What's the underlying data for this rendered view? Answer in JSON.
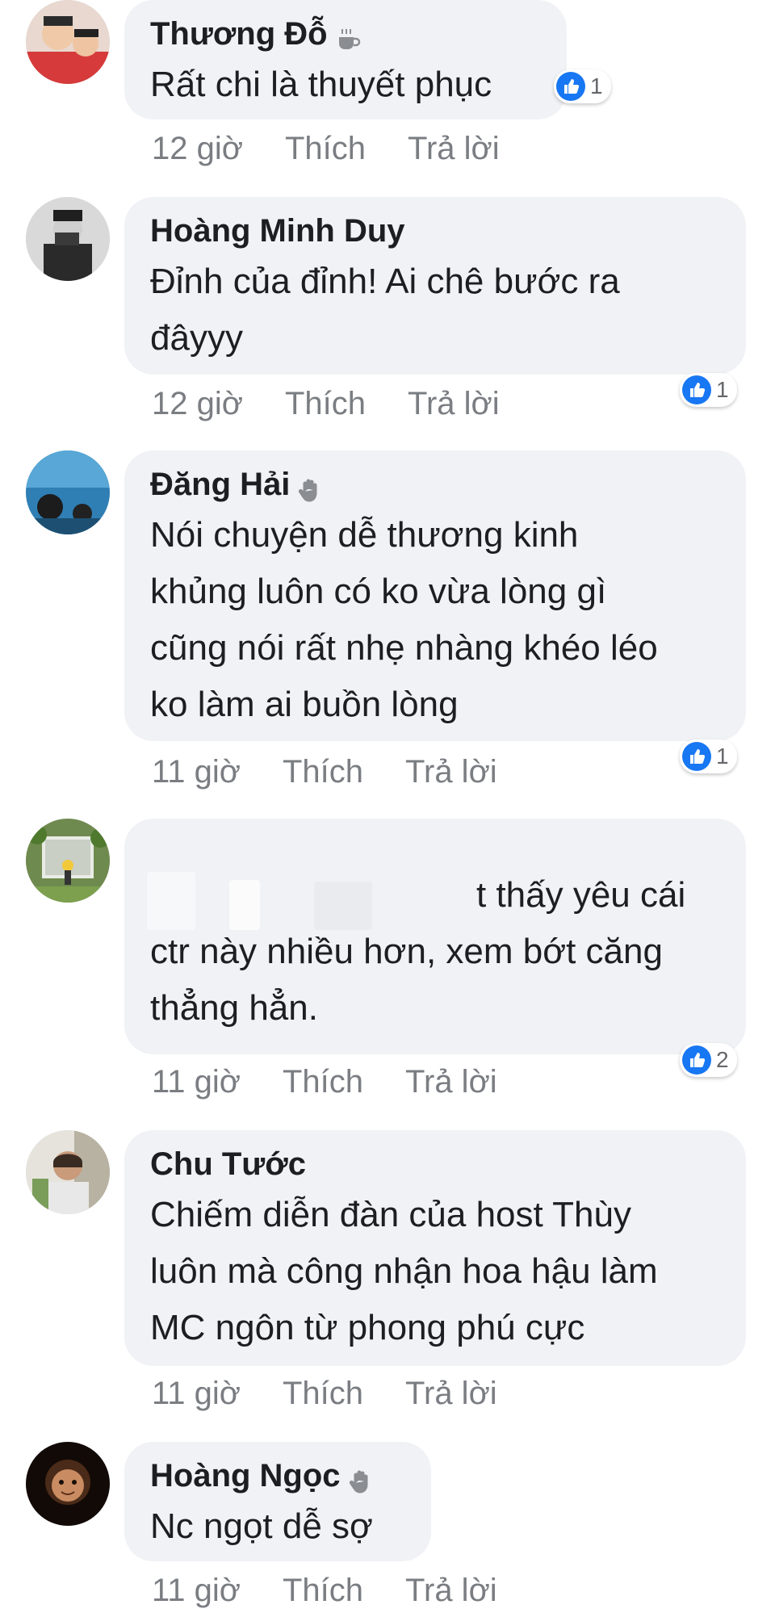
{
  "comments": [
    {
      "name": "Thương Đỗ",
      "badge": "coffee-icon",
      "text": "Rất chi là thuyết phục",
      "time": "12 giờ",
      "like": "Thích",
      "reply": "Trả lời",
      "reactions": "1"
    },
    {
      "name": "Hoàng Minh Duy",
      "text": "Đỉnh của đỉnh! Ai chê bước ra\nđâyyy",
      "time": "12 giờ",
      "like": "Thích",
      "reply": "Trả lời",
      "reactions": "1"
    },
    {
      "name": "Đăng Hải",
      "badge": "wave-hand-icon",
      "text": "Nói chuyện dễ thương kinh\nkhủng luôn có ko vừa lòng gì\ncũng nói rất nhẹ nhàng khéo léo\nko làm ai buồn lòng",
      "time": "11 giờ",
      "like": "Thích",
      "reply": "Trả lời",
      "reactions": "1"
    },
    {
      "name": "",
      "text": "t thấy yêu cái\nctr này nhiều hơn, xem bớt căng\nthẳng hẳn.",
      "time": "11 giờ",
      "like": "Thích",
      "reply": "Trả lời",
      "reactions": "2"
    },
    {
      "name": "Chu Tước",
      "text": "Chiếm diễn đàn của host Thùy\nluôn mà công nhận hoa hậu làm\nMC ngôn từ phong phú cực",
      "time": "11 giờ",
      "like": "Thích",
      "reply": "Trả lời"
    },
    {
      "name": "Hoàng Ngọc",
      "badge": "wave-hand-icon",
      "text": "Nc ngọt dễ sợ",
      "time": "11 giờ",
      "like": "Thích",
      "reply": "Trả lời"
    }
  ],
  "colors": {
    "bubble": "#f0f2f5",
    "like_blue": "#1877f2",
    "meta_gray": "#7a7d82"
  }
}
